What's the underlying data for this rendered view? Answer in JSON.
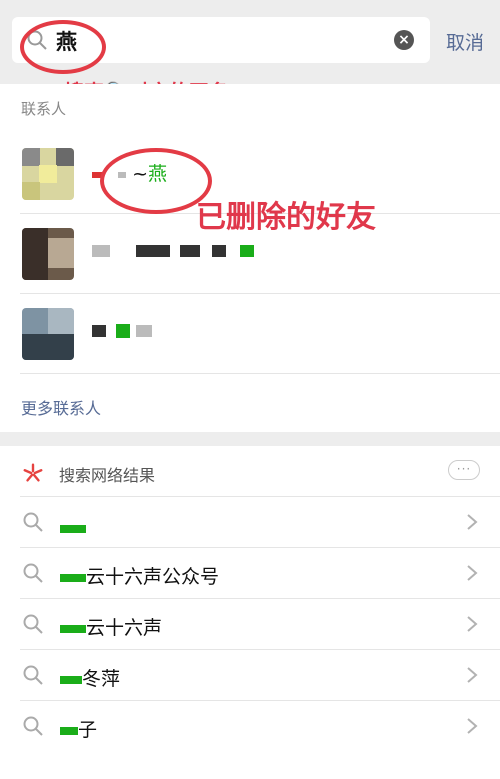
{
  "search": {
    "query": "燕",
    "clear_icon": "clear-icon",
    "cancel_label": "取消"
  },
  "annotations": {
    "search_hint": "搜索🔍对方的网名",
    "deleted_friend": "已删除的好友"
  },
  "contacts": {
    "title": "联系人",
    "items": [
      {
        "name_prefix": "~",
        "highlight": "燕"
      },
      {
        "name_prefix": "",
        "highlight": ""
      },
      {
        "name_prefix": "",
        "highlight": ""
      }
    ],
    "more_label": "更多联系人"
  },
  "web_search": {
    "title": "搜索网络结果",
    "more_label": "···",
    "results": [
      {
        "text": ""
      },
      {
        "text": "云十六声公众号"
      },
      {
        "text": "云十六声"
      },
      {
        "text": "冬萍"
      },
      {
        "text": "子"
      }
    ]
  },
  "colors": {
    "link": "#576b95",
    "highlight": "#1aad19",
    "annotation": "#e0384b"
  }
}
